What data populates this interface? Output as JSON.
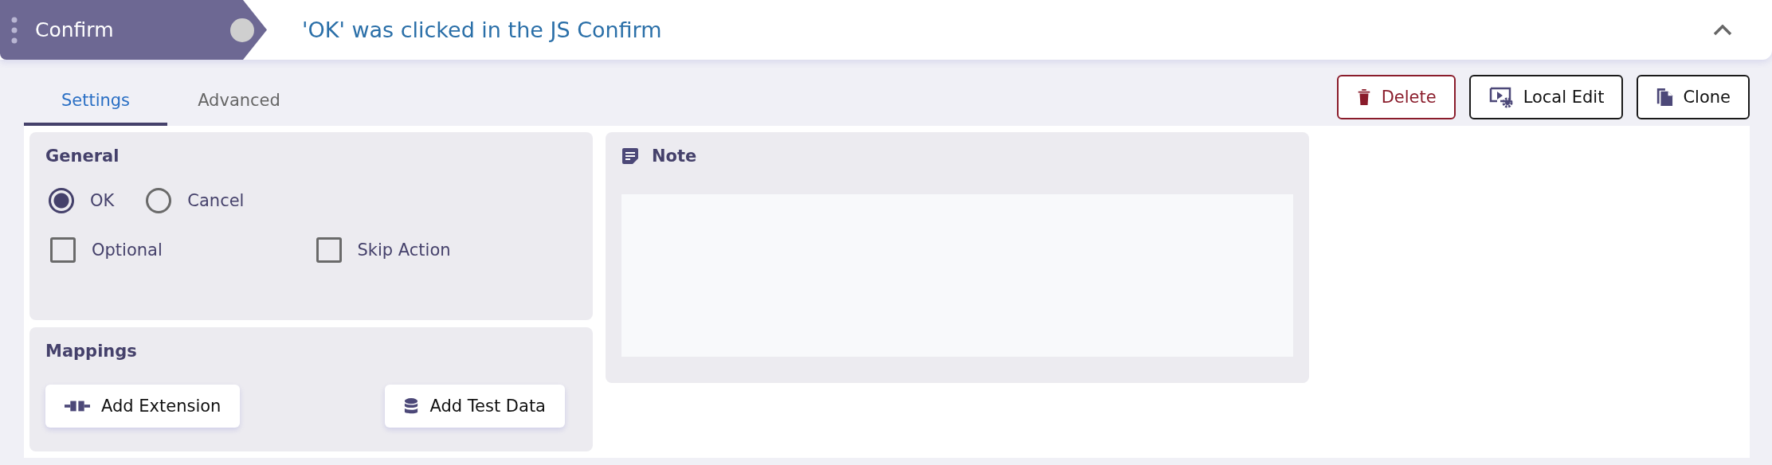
{
  "step": {
    "name": "Confirm",
    "description": "'OK' was clicked in the JS Confirm",
    "expanded": true
  },
  "tabs": [
    {
      "label": "Settings",
      "selected": true
    },
    {
      "label": "Advanced",
      "selected": false
    }
  ],
  "actions": [
    {
      "label": "Delete",
      "kind": "delete"
    },
    {
      "label": "Local Edit",
      "kind": "local-edit"
    },
    {
      "label": "Clone",
      "kind": "clone"
    }
  ],
  "general": {
    "title": "General",
    "options": [
      {
        "label": "OK",
        "selected": true
      },
      {
        "label": "Cancel",
        "selected": false
      }
    ],
    "checkboxes": [
      {
        "label": "Optional",
        "checked": false
      },
      {
        "label": "Skip Action",
        "checked": false
      }
    ]
  },
  "mappings": {
    "title": "Mappings",
    "buttons": [
      {
        "label": "Add Extension",
        "kind": "extension"
      },
      {
        "label": "Add Test Data",
        "kind": "test-data"
      }
    ]
  },
  "note": {
    "title": "Note"
  }
}
